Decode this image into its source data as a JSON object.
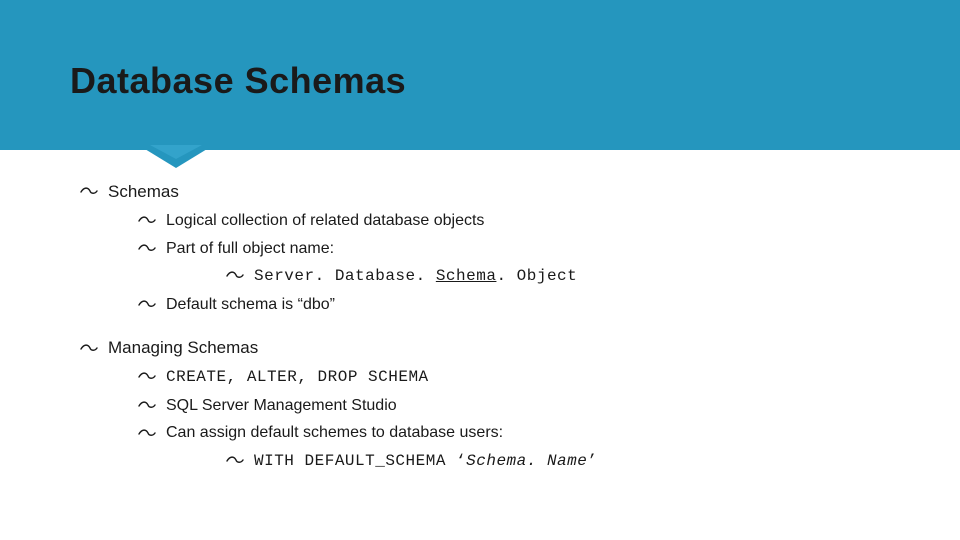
{
  "title": "Database Schemas",
  "bullets": {
    "b1": "Schemas",
    "b1_1": "Logical collection of related database objects",
    "b1_2": "Part of full object name:",
    "b1_2_1_pre": "Server. Database. ",
    "b1_2_1_schema": "Schema",
    "b1_2_1_post": ". Object",
    "b1_3": "Default schema is “dbo”",
    "b2": "Managing Schemas",
    "b2_1": "CREATE, ALTER, DROP SCHEMA",
    "b2_2": "SQL Server Management Studio",
    "b2_3": "Can assign default schemes to database users:",
    "b2_3_1_pre": "WITH DEFAULT_SCHEMA ‘",
    "b2_3_1_name": "Schema. Name",
    "b2_3_1_post": "’"
  }
}
